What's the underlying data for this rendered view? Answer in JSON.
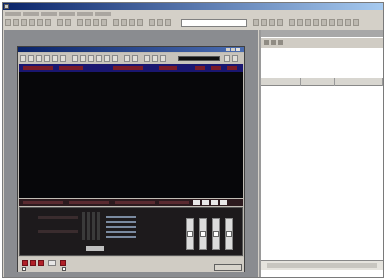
{
  "window": {
    "title": ""
  },
  "menu": {
    "items": [
      "",
      "",
      "",
      "",
      "",
      ""
    ]
  },
  "inner_window": {
    "title": ""
  },
  "mixer": {
    "labels": [
      "",
      ""
    ]
  },
  "options": {
    "checkbox_1": "",
    "checkbox_2": ""
  },
  "dialog": {
    "ok_label": ""
  },
  "right_panel": {
    "title": "",
    "columns": [
      "",
      "",
      ""
    ]
  },
  "colors": {
    "title_gradient_start": "#0a246a",
    "track_header": "#1a1670",
    "record_red": "#b02028"
  }
}
